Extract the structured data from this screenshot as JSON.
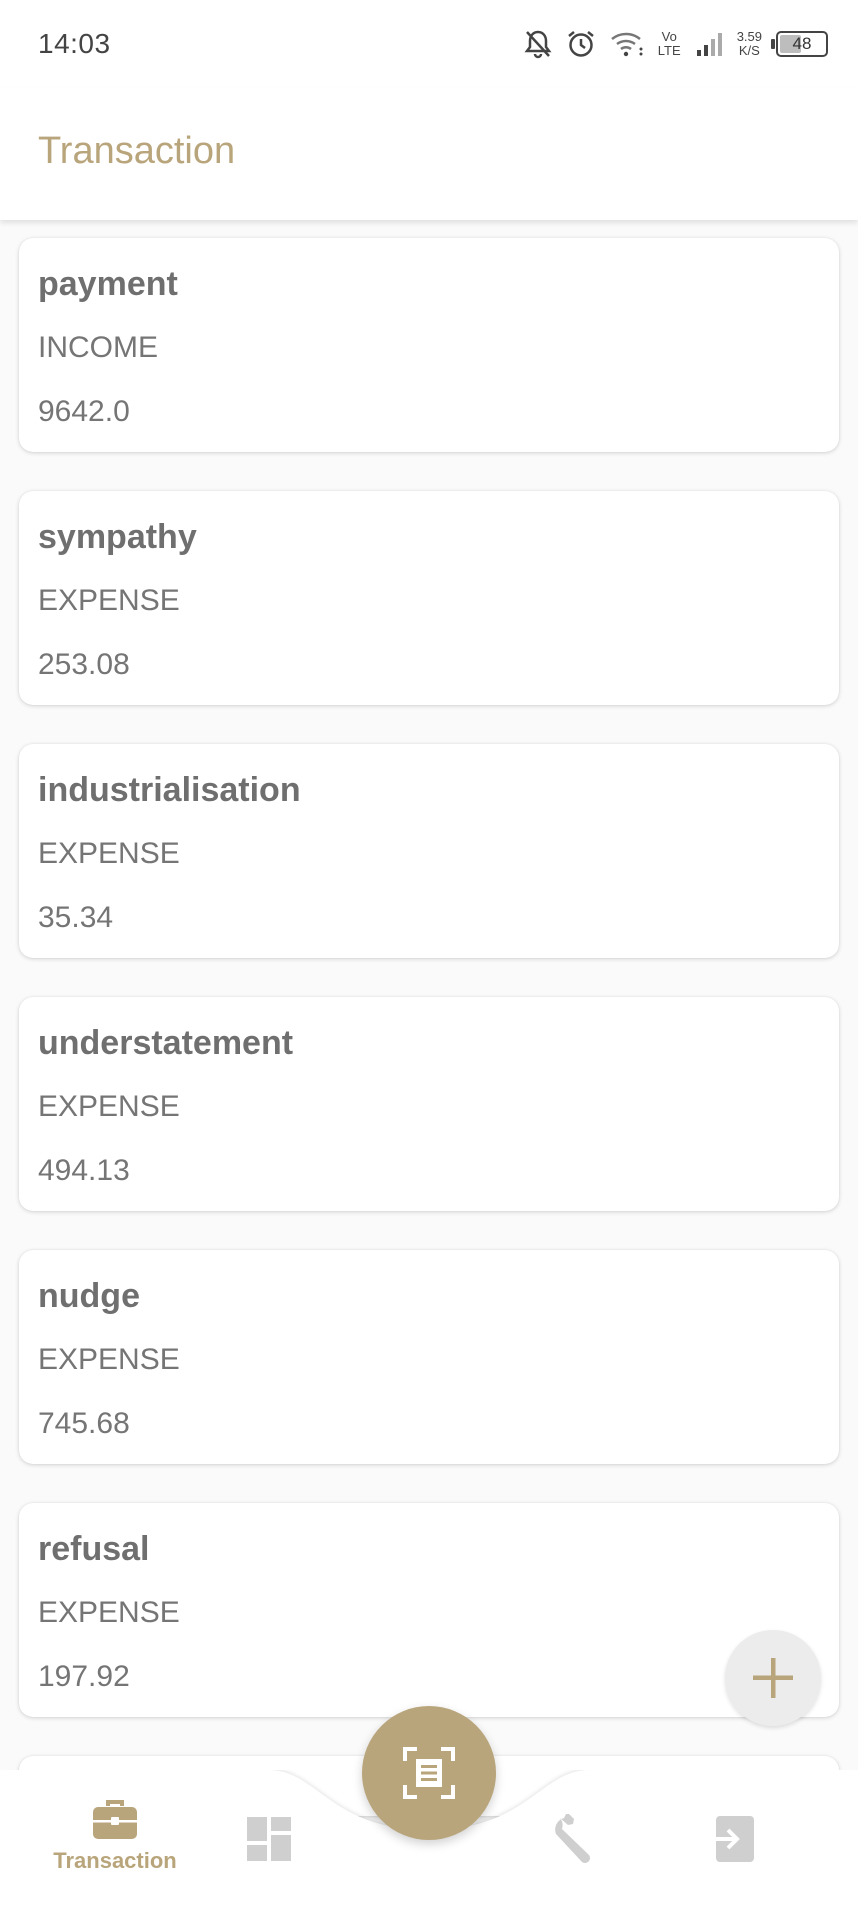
{
  "status_bar": {
    "time": "14:03",
    "network_type_top": "Vo",
    "network_type_bottom": "LTE",
    "speed_value": "3.59",
    "speed_unit": "K/S",
    "battery": "48",
    "battery_level": 0.48
  },
  "app_bar": {
    "title": "Transaction"
  },
  "transactions": [
    {
      "title": "payment",
      "type": "INCOME",
      "amount": "9642.0"
    },
    {
      "title": "sympathy",
      "type": "EXPENSE",
      "amount": "253.08"
    },
    {
      "title": "industrialisation",
      "type": "EXPENSE",
      "amount": "35.34"
    },
    {
      "title": "understatement",
      "type": "EXPENSE",
      "amount": "494.13"
    },
    {
      "title": "nudge",
      "type": "EXPENSE",
      "amount": "745.68"
    },
    {
      "title": "refusal",
      "type": "EXPENSE",
      "amount": "197.92"
    }
  ],
  "fab": {
    "icon": "plus-icon"
  },
  "bottom_nav": {
    "items": [
      {
        "icon": "briefcase-icon",
        "label": "Transaction",
        "active": true
      },
      {
        "icon": "dashboard-icon",
        "label": "",
        "active": false
      },
      {
        "icon": "scan-document-icon",
        "label": "",
        "active": false
      },
      {
        "icon": "wrench-icon",
        "label": "",
        "active": false
      },
      {
        "icon": "logout-icon",
        "label": "",
        "active": false
      }
    ]
  },
  "colors": {
    "accent": "#b9a57b",
    "inactive_icon": "#cfcfcf",
    "text_primary": "#6f6f6f",
    "text_secondary": "#757575",
    "background": "#fafafa"
  }
}
